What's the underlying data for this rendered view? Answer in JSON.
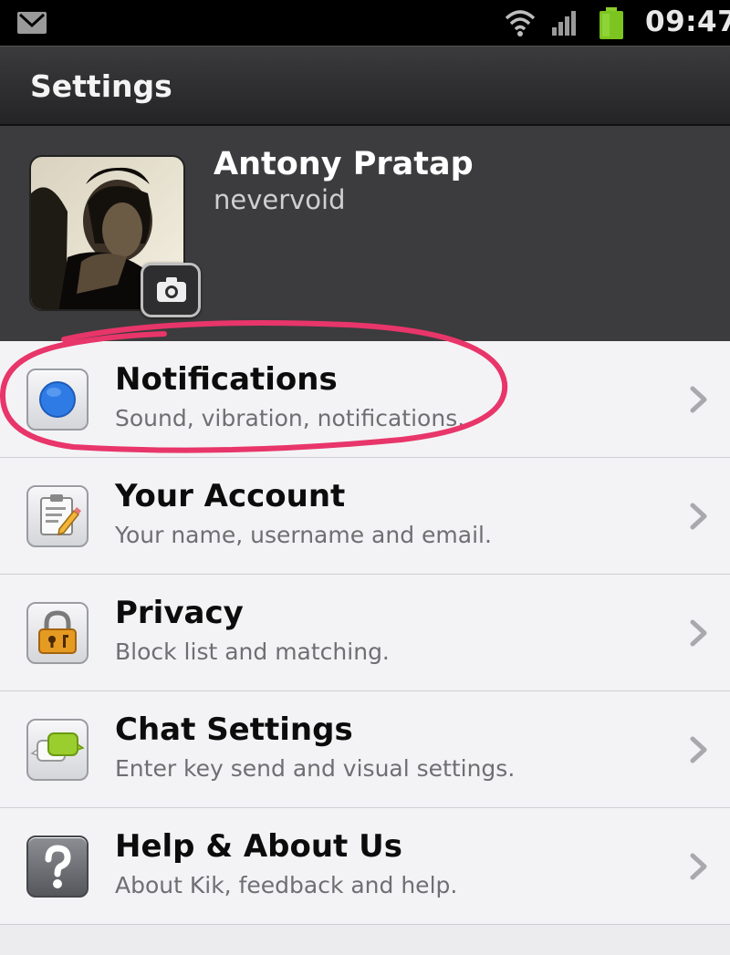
{
  "status_bar": {
    "time": "09:47",
    "icons": [
      "mail-icon",
      "wifi-icon",
      "signal-icon",
      "battery-icon"
    ],
    "battery_color": "#7cc41f"
  },
  "header": {
    "title": "Settings"
  },
  "profile": {
    "name": "Antony Pratap",
    "username": "nevervoid",
    "camera_icon": "camera-icon"
  },
  "settings": {
    "items": [
      {
        "title": "Notifications",
        "subtitle": "Sound, vibration, notifications.",
        "icon": "notification-dot-icon",
        "highlighted": true
      },
      {
        "title": "Your Account",
        "subtitle": "Your name, username and email.",
        "icon": "account-clipboard-icon"
      },
      {
        "title": "Privacy",
        "subtitle": "Block list and matching.",
        "icon": "padlock-icon"
      },
      {
        "title": "Chat Settings",
        "subtitle": "Enter key send and visual settings.",
        "icon": "chat-bubbles-icon"
      },
      {
        "title": "Help & About Us",
        "subtitle": "About Kik, feedback and help.",
        "icon": "question-mark-icon"
      }
    ]
  },
  "colors": {
    "accent_blue": "#2f7be6",
    "highlight_annotation": "#e8356a",
    "chat_green": "#9acd2e",
    "lock_orange": "#e59a22"
  }
}
